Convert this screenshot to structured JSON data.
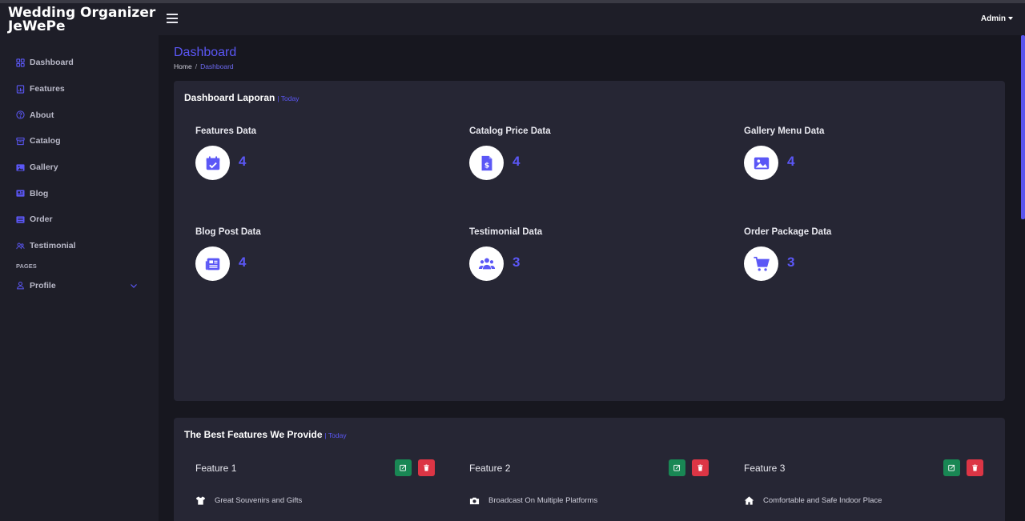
{
  "brand": {
    "line1": "Wedding Organizer",
    "line2": "JeWePe"
  },
  "sidebar": {
    "items": [
      {
        "label": "Dashboard",
        "icon": "grid-icon"
      },
      {
        "label": "Features",
        "icon": "chart-icon"
      },
      {
        "label": "About",
        "icon": "question-icon"
      },
      {
        "label": "Catalog",
        "icon": "archive-icon"
      },
      {
        "label": "Gallery",
        "icon": "image-icon"
      },
      {
        "label": "Blog",
        "icon": "newspaper-icon"
      },
      {
        "label": "Order",
        "icon": "cart-icon"
      },
      {
        "label": "Testimonial",
        "icon": "people-icon"
      }
    ],
    "heading": "PAGES",
    "profile": {
      "label": "Profile",
      "icon": "person-icon"
    }
  },
  "header": {
    "user": "Admin"
  },
  "page": {
    "title": "Dashboard",
    "breadcrumb": {
      "home": "Home",
      "sep": "/",
      "current": "Dashboard"
    }
  },
  "report": {
    "title": "Dashboard Laporan",
    "subtitle": "| Today",
    "stats": [
      {
        "label": "Features Data",
        "value": "4",
        "icon": "calendar-check-icon"
      },
      {
        "label": "Catalog Price Data",
        "value": "4",
        "icon": "receipt-dollar-icon"
      },
      {
        "label": "Gallery Menu Data",
        "value": "4",
        "icon": "image-icon"
      },
      {
        "label": "Blog Post Data",
        "value": "4",
        "icon": "newspaper-icon"
      },
      {
        "label": "Testimonial Data",
        "value": "3",
        "icon": "people-icon"
      },
      {
        "label": "Order Package Data",
        "value": "3",
        "icon": "cart-icon"
      }
    ]
  },
  "features": {
    "title": "The Best Features We Provide",
    "subtitle": "| Today",
    "items": [
      {
        "name": "Feature 1",
        "text": "Great Souvenirs and Gifts",
        "icon": "tshirt-icon"
      },
      {
        "name": "Feature 2",
        "text": "Broadcast On Multiple Platforms",
        "icon": "camera-icon"
      },
      {
        "name": "Feature 3",
        "text": "Comfortable and Safe Indoor Place",
        "icon": "home-icon"
      }
    ]
  },
  "colors": {
    "accent": "#5b57f6",
    "edit": "#198754",
    "delete": "#dc3545",
    "card": "#262634",
    "sidebar": "#1e1e28"
  }
}
